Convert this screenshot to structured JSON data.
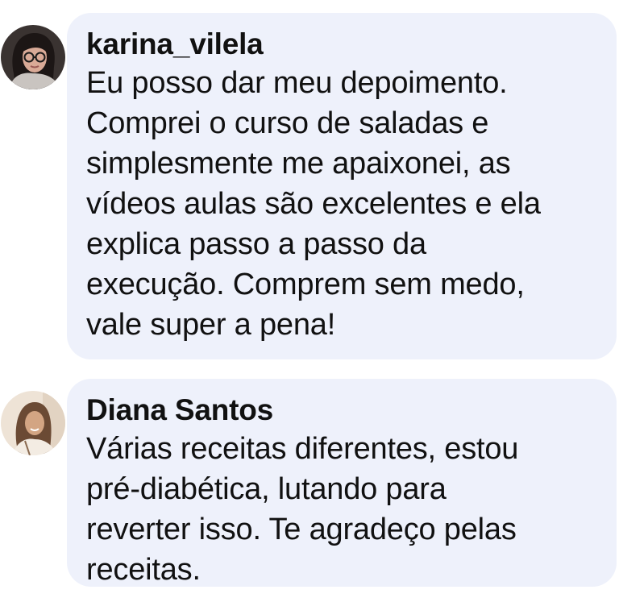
{
  "comments": [
    {
      "author": "karina_vilela",
      "text": "Eu posso dar meu depoimento.\nComprei o curso de saladas e\nsimplesmente me apaixonei, as\nvídeos aulas são excelentes e ela\nexplica passo a passo da\nexecução. Comprem sem medo,\nvale super a pena!",
      "avatar_colors": {
        "bg": "#3a3331",
        "hair": "#1c1615",
        "skin": "#d9aa97",
        "sweater": "#c9c4c0"
      }
    },
    {
      "author": "Diana Santos",
      "text": "Várias receitas diferentes, estou\npré-diabética, lutando para\nreverter isso. Te agradeço pelas\nreceitas.",
      "avatar_colors": {
        "bg": "#eee3d6",
        "hair": "#6b4a34",
        "skin": "#d3a583",
        "shirt": "#f3ece3"
      }
    }
  ],
  "colors": {
    "bubble": "#eef1fb",
    "text": "#111111",
    "page": "#ffffff"
  }
}
